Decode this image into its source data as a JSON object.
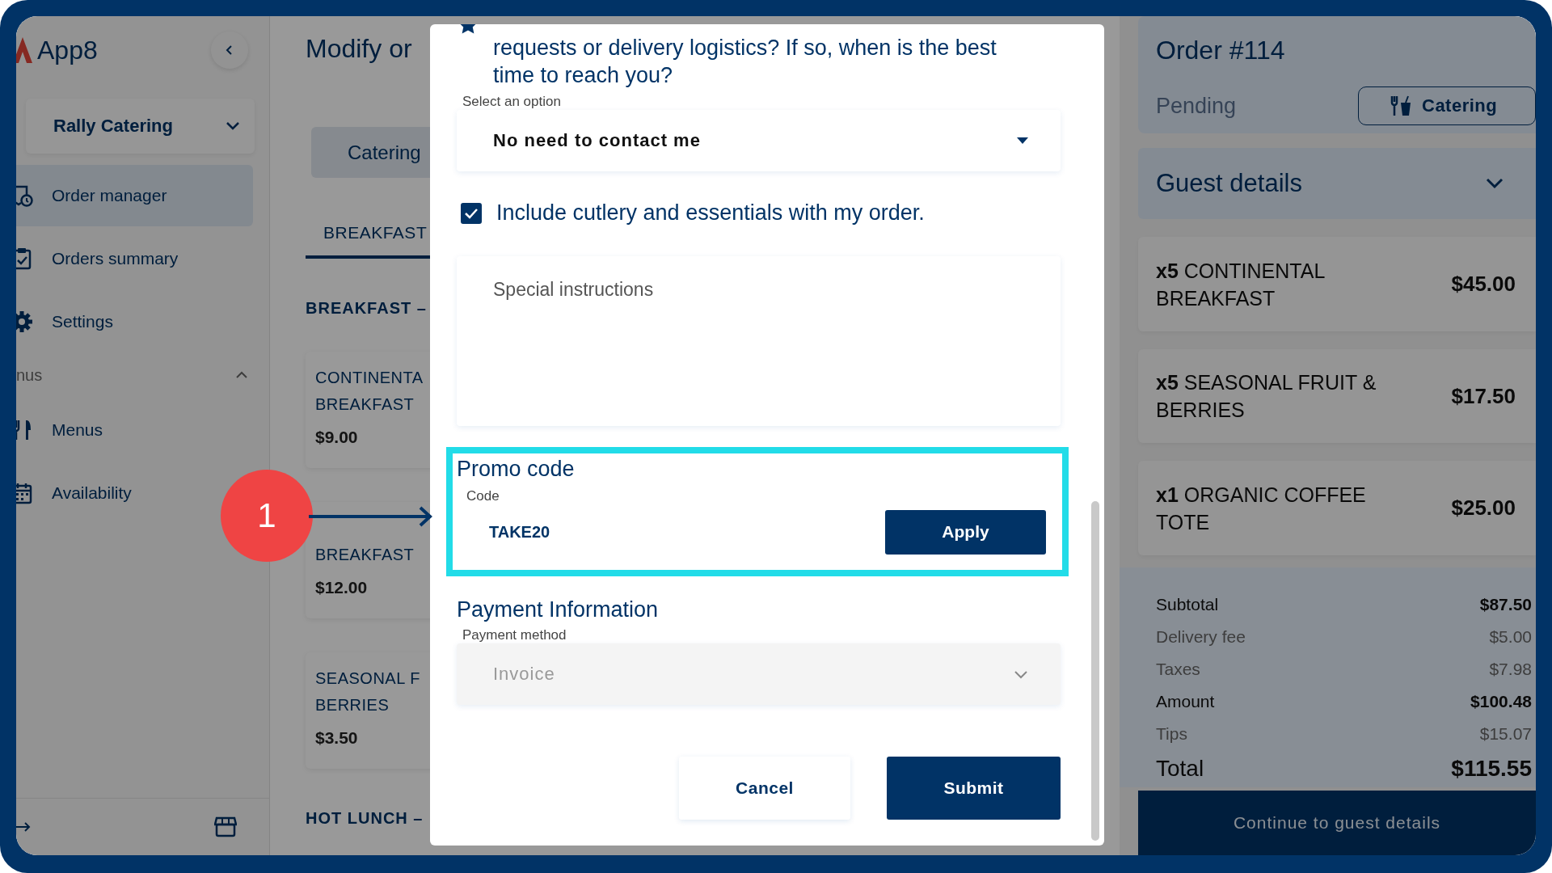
{
  "sidebar": {
    "logo": "App8",
    "restaurant": "Rally Catering",
    "nav": [
      {
        "label": "Order manager",
        "selected": true
      },
      {
        "label": "Orders summary",
        "selected": false
      },
      {
        "label": "Settings",
        "selected": false
      }
    ],
    "section": {
      "label": "nus",
      "expanded": true
    },
    "section_items": [
      {
        "label": "Menus",
        "selected": false
      },
      {
        "label": "Availability",
        "selected": false
      }
    ]
  },
  "main": {
    "title": "Modify or",
    "channel_tab": "Catering",
    "menu_tabs": [
      {
        "label": "BREAKFAST",
        "selected": true
      }
    ],
    "sections": [
      {
        "heading": "BREAKFAST –",
        "items": [
          {
            "lines": [
              "CONTINENTA",
              "BREAKFAST"
            ],
            "price": "$9.00"
          },
          {
            "lines": [
              "BREAKFAST"
            ],
            "price": "$12.00"
          },
          {
            "lines": [
              "SEASONAL F",
              "BERRIES"
            ],
            "price": "$3.50"
          }
        ]
      },
      {
        "heading": "HOT LUNCH –"
      }
    ]
  },
  "modal": {
    "question_lines": [
      "requests or delivery logistics? If so, when is the best",
      "time to reach you?"
    ],
    "contact_select": {
      "label": "Select an option",
      "value": "No need to contact me"
    },
    "cutlery": {
      "label": "Include cutlery and essentials with my order.",
      "checked": true
    },
    "instructions": {
      "placeholder": "Special instructions"
    },
    "promo": {
      "title": "Promo code",
      "label": "Code",
      "value": "TAKE20",
      "button": "Apply",
      "highlighted": true
    },
    "payment": {
      "title": "Payment Information",
      "label": "Payment method",
      "value": "Invoice",
      "disabled": true
    },
    "buttons": [
      {
        "label": "Cancel",
        "kind": "secondary"
      },
      {
        "label": "Submit",
        "kind": "primary"
      }
    ]
  },
  "annotation": {
    "step": "1"
  },
  "order": {
    "title": "Order #114",
    "status": "Pending",
    "type": "Catering",
    "guest_details": {
      "label": "Guest details",
      "expanded": false
    },
    "items": [
      {
        "text": "**x5**  CONTINENTAL BREAKFAST",
        "price": "$45.00"
      },
      {
        "text": "**x5**  SEASONAL FRUIT & BERRIES",
        "price": "$17.50"
      },
      {
        "text": "**x1**  ORGANIC COFFEE TOTE",
        "price": "$25.00"
      }
    ],
    "totals": [
      {
        "label": "Subtotal",
        "value": "$87.50",
        "kind": "strong"
      },
      {
        "label": "Delivery fee",
        "value": "$5.00",
        "kind": "muted"
      },
      {
        "label": "Taxes",
        "value": "$7.98",
        "kind": "muted"
      },
      {
        "label": "Amount",
        "value": "$100.48",
        "kind": "strong"
      },
      {
        "label": "Tips",
        "value": "$15.07",
        "kind": "muted"
      },
      {
        "label": "Total",
        "value": "$115.55",
        "kind": "grand"
      }
    ],
    "continue_button": "Continue to guest details"
  }
}
